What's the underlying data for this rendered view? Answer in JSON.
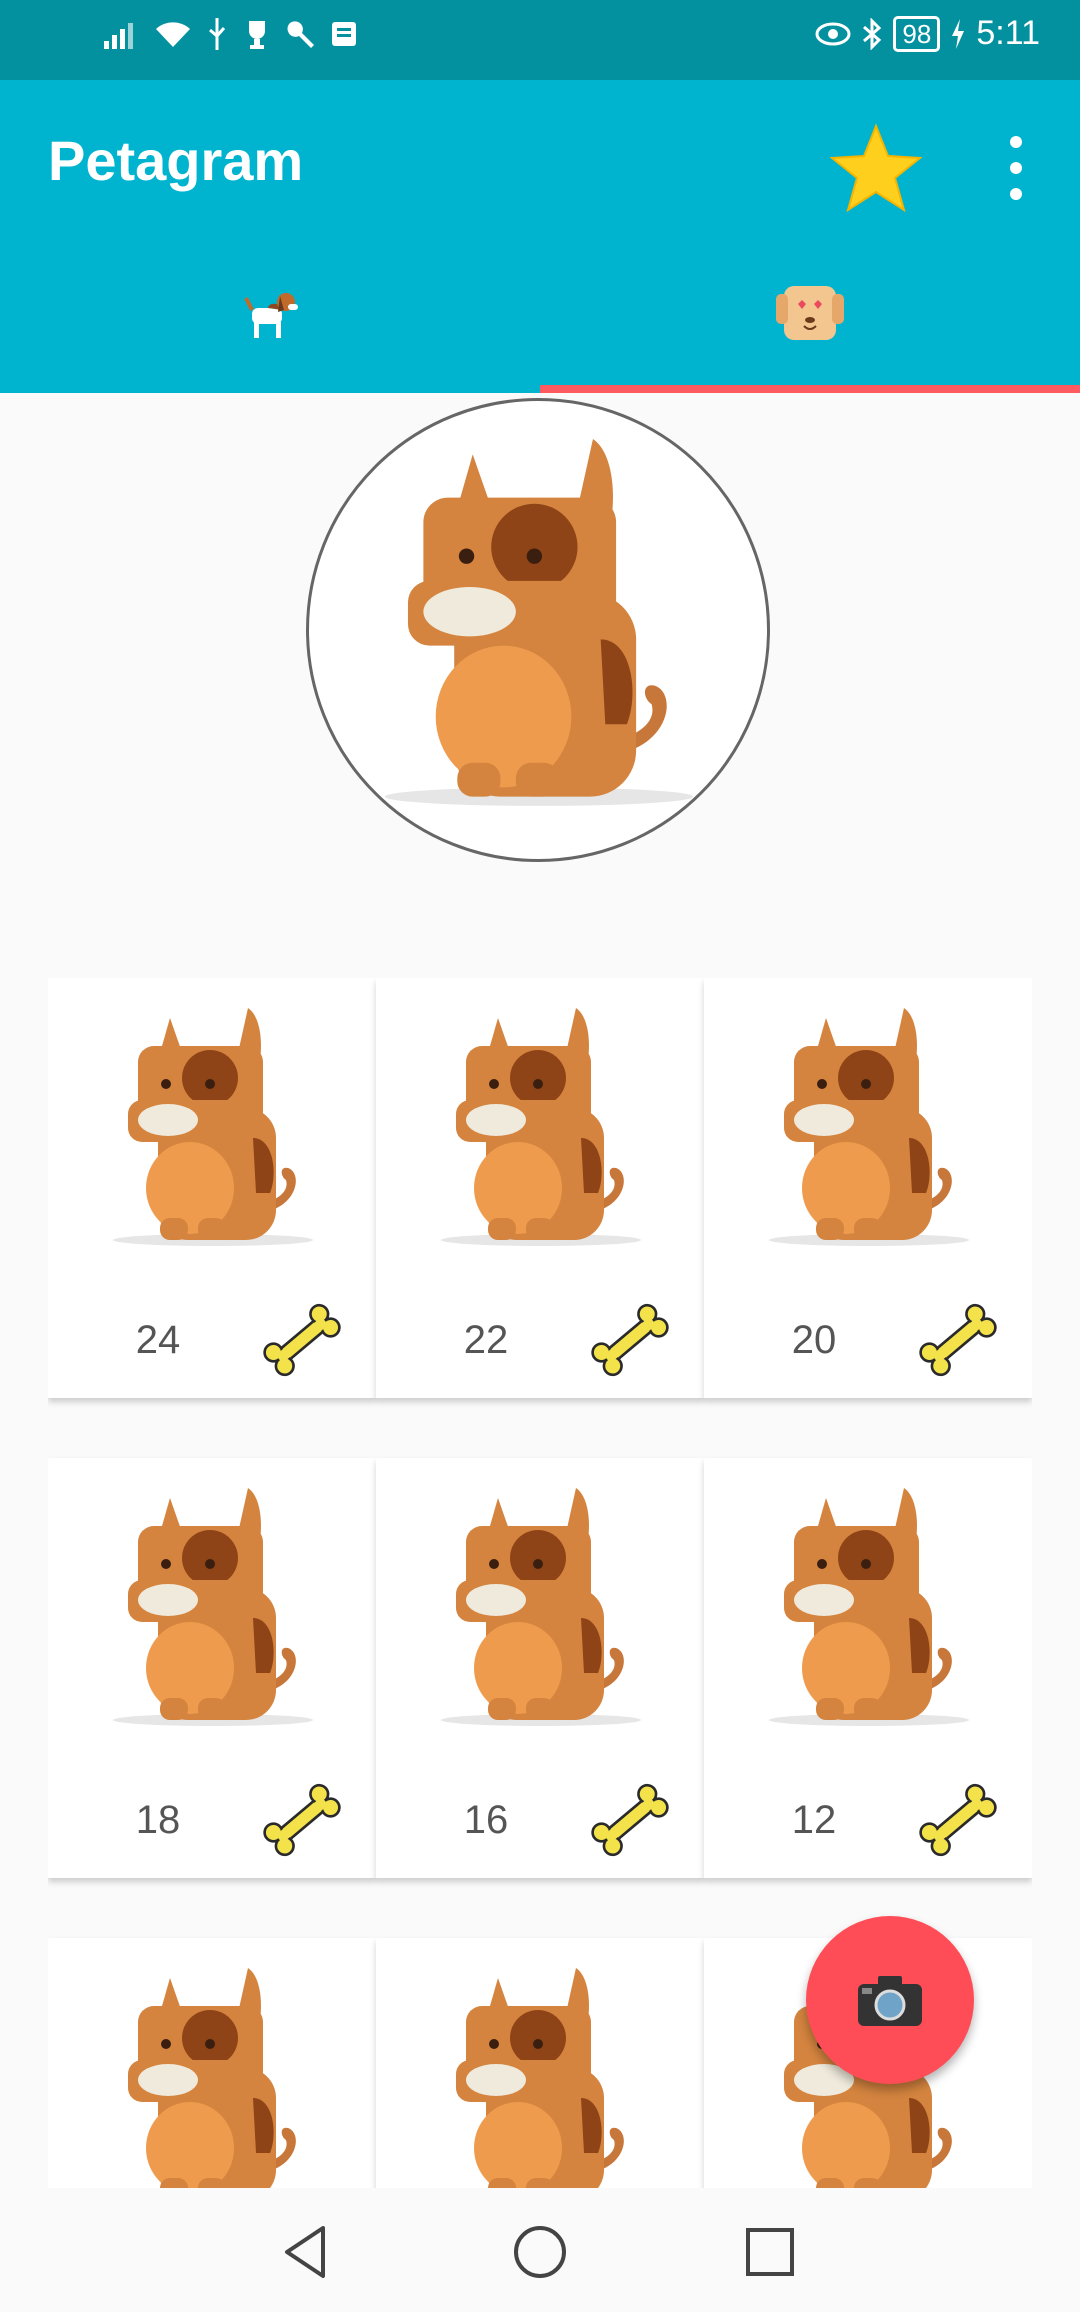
{
  "status_bar": {
    "time": "5:11",
    "battery": "98",
    "icons": [
      "signal-icon",
      "wifi-icon",
      "usb-icon",
      "trophy-icon",
      "wrench-icon",
      "notification-icon",
      "eye-icon",
      "bluetooth-icon",
      "charging-icon"
    ]
  },
  "app_bar": {
    "title": "Petagram",
    "color": "#00b4d0",
    "actions": [
      "star-icon",
      "more-icon"
    ]
  },
  "tabs": [
    {
      "icon": "beagle-dog-icon",
      "selected": false
    },
    {
      "icon": "dog-love-icon",
      "selected": true
    }
  ],
  "profile": {
    "image": "dog-avatar"
  },
  "grid": {
    "items": [
      {
        "count": "24"
      },
      {
        "count": "22"
      },
      {
        "count": "20"
      },
      {
        "count": "18"
      },
      {
        "count": "16"
      },
      {
        "count": "12"
      },
      {
        "count": ""
      },
      {
        "count": ""
      },
      {
        "count": ""
      }
    ]
  },
  "fab": {
    "icon": "camera-icon",
    "color": "#ff4d57"
  },
  "nav": [
    "back-icon",
    "home-icon",
    "recents-icon"
  ]
}
